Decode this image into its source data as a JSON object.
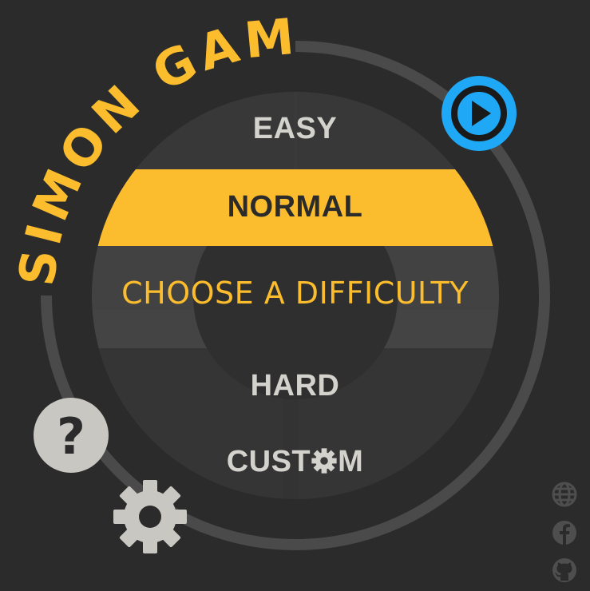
{
  "title": "SIMON GAME",
  "difficulty_prompt": "CHOOSE A DIFFICULTY",
  "difficulties": [
    {
      "label": "EASY",
      "selected": false
    },
    {
      "label": "NORMAL",
      "selected": true
    },
    {
      "label": "HARD",
      "selected": false
    },
    {
      "label": "CUST⚙M",
      "display_prefix": "CUST",
      "display_suffix": "M",
      "selected": false
    }
  ],
  "controls": {
    "play": "play-icon",
    "help": "question-mark-icon",
    "settings": "gear-icon"
  },
  "links": [
    "globe-icon",
    "facebook-icon",
    "github-icon"
  ],
  "colors": {
    "background": "#2b2b2b",
    "accent": "#fbbd2e",
    "play_button": "#1ea8f5",
    "text": "#d4d2cc",
    "ring": "#4a4a4a"
  }
}
